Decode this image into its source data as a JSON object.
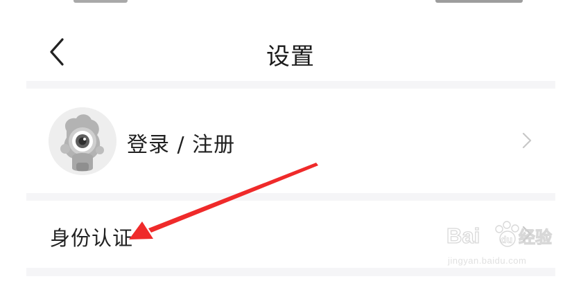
{
  "nav": {
    "title": "设置",
    "back_icon": "chevron-left-icon"
  },
  "account": {
    "login_label": "登录 / 注册",
    "avatar_icon": "robot-avatar-icon",
    "chevron_icon": "chevron-right-icon"
  },
  "settings": {
    "identity_label": "身份认证",
    "chevron_icon": "chevron-right-icon"
  },
  "annotation": {
    "icon": "red-arrow-annotation",
    "color": "#ef2a2a"
  },
  "watermark": {
    "logo_text": "Baidu经验",
    "url": "jingyan.baidu.com"
  },
  "colors": {
    "title": "#1b1b1b",
    "text": "#202020",
    "divider": "#f5f5f7",
    "chevron": "#c7c7c7",
    "arrow": "#ef2a2a"
  }
}
